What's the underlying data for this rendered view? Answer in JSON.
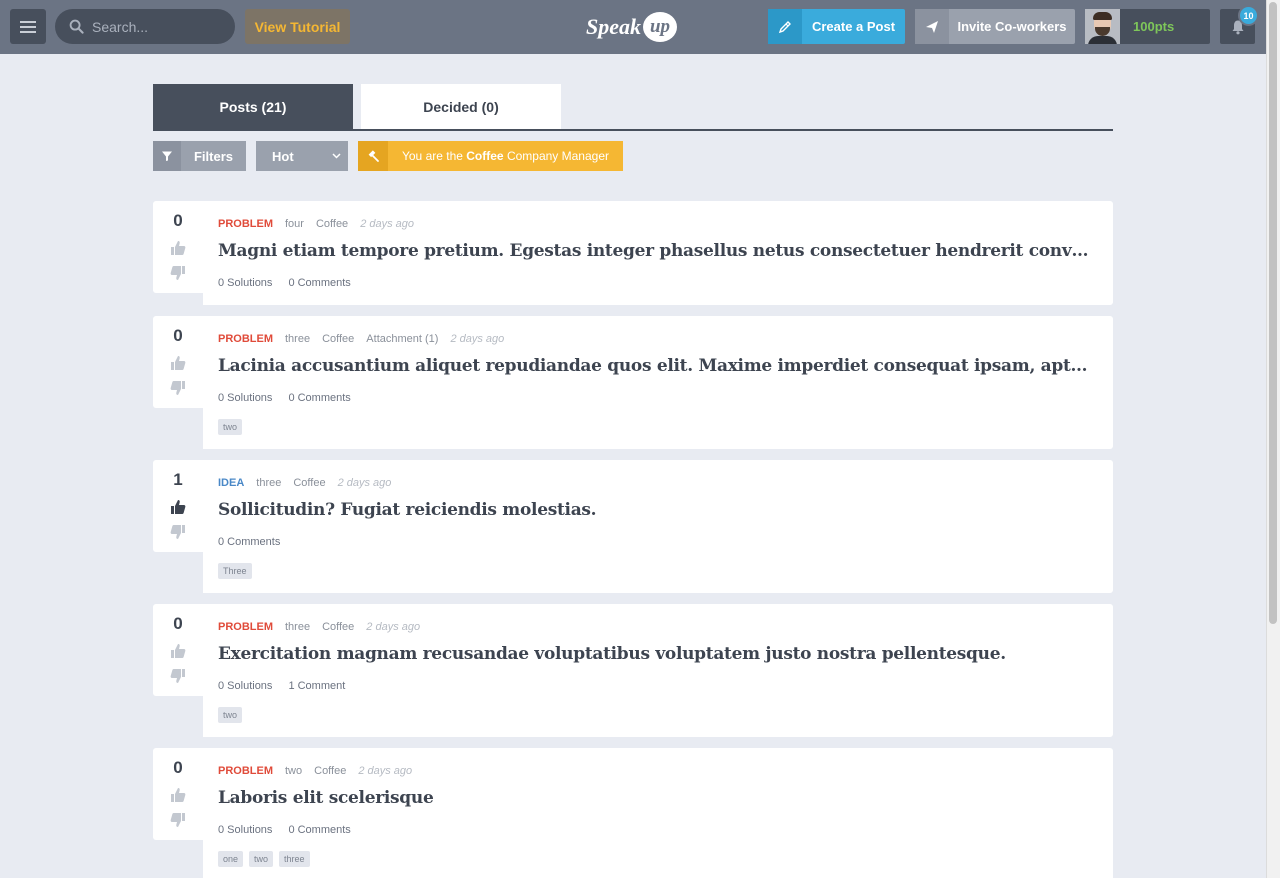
{
  "header": {
    "search_placeholder": "Search...",
    "tutorial_label": "View Tutorial",
    "logo_word": "Speak",
    "logo_bubble": "up",
    "create_post_label": "Create a Post",
    "invite_label": "Invite Co-workers",
    "points": "100pts",
    "notification_count": "10"
  },
  "tabs": {
    "posts": "Posts (21)",
    "decided": "Decided (0)"
  },
  "toolbar": {
    "filters_label": "Filters",
    "sort_value": "Hot",
    "manager_prefix": "You are the ",
    "manager_company": "Coffee",
    "manager_suffix": " Company Manager"
  },
  "posts": [
    {
      "votes": "0",
      "kind": "PROBLEM",
      "meta": [
        "four",
        "Coffee"
      ],
      "time": "2 days ago",
      "title": "Magni etiam tempore pretium. Egestas integer phasellus netus consectetuer hendrerit convallis dictum",
      "counts": [
        "0 Solutions",
        "0 Comments"
      ],
      "tags": []
    },
    {
      "votes": "0",
      "kind": "PROBLEM",
      "meta": [
        "three",
        "Coffee",
        "Attachment (1)"
      ],
      "time": "2 days ago",
      "title": "Lacinia accusantium aliquet repudiandae quos elit. Maxime imperdiet consequat ipsam, aptent sapiente",
      "counts": [
        "0 Solutions",
        "0 Comments"
      ],
      "tags": [
        "two"
      ]
    },
    {
      "votes": "1",
      "kind": "IDEA",
      "meta": [
        "three",
        "Coffee"
      ],
      "time": "2 days ago",
      "title": "Sollicitudin? Fugiat reiciendis molestias.",
      "counts": [
        "0 Comments"
      ],
      "tags": [
        "Three"
      ],
      "upvoted": true
    },
    {
      "votes": "0",
      "kind": "PROBLEM",
      "meta": [
        "three",
        "Coffee"
      ],
      "time": "2 days ago",
      "title": "Exercitation magnam recusandae voluptatibus voluptatem justo nostra pellentesque.",
      "counts": [
        "0 Solutions",
        "1 Comment"
      ],
      "tags": [
        "two"
      ]
    },
    {
      "votes": "0",
      "kind": "PROBLEM",
      "meta": [
        "two",
        "Coffee"
      ],
      "time": "2 days ago",
      "title": "Laboris elit scelerisque",
      "counts": [
        "0 Solutions",
        "0 Comments"
      ],
      "tags": [
        "one",
        "two",
        "three"
      ]
    }
  ]
}
